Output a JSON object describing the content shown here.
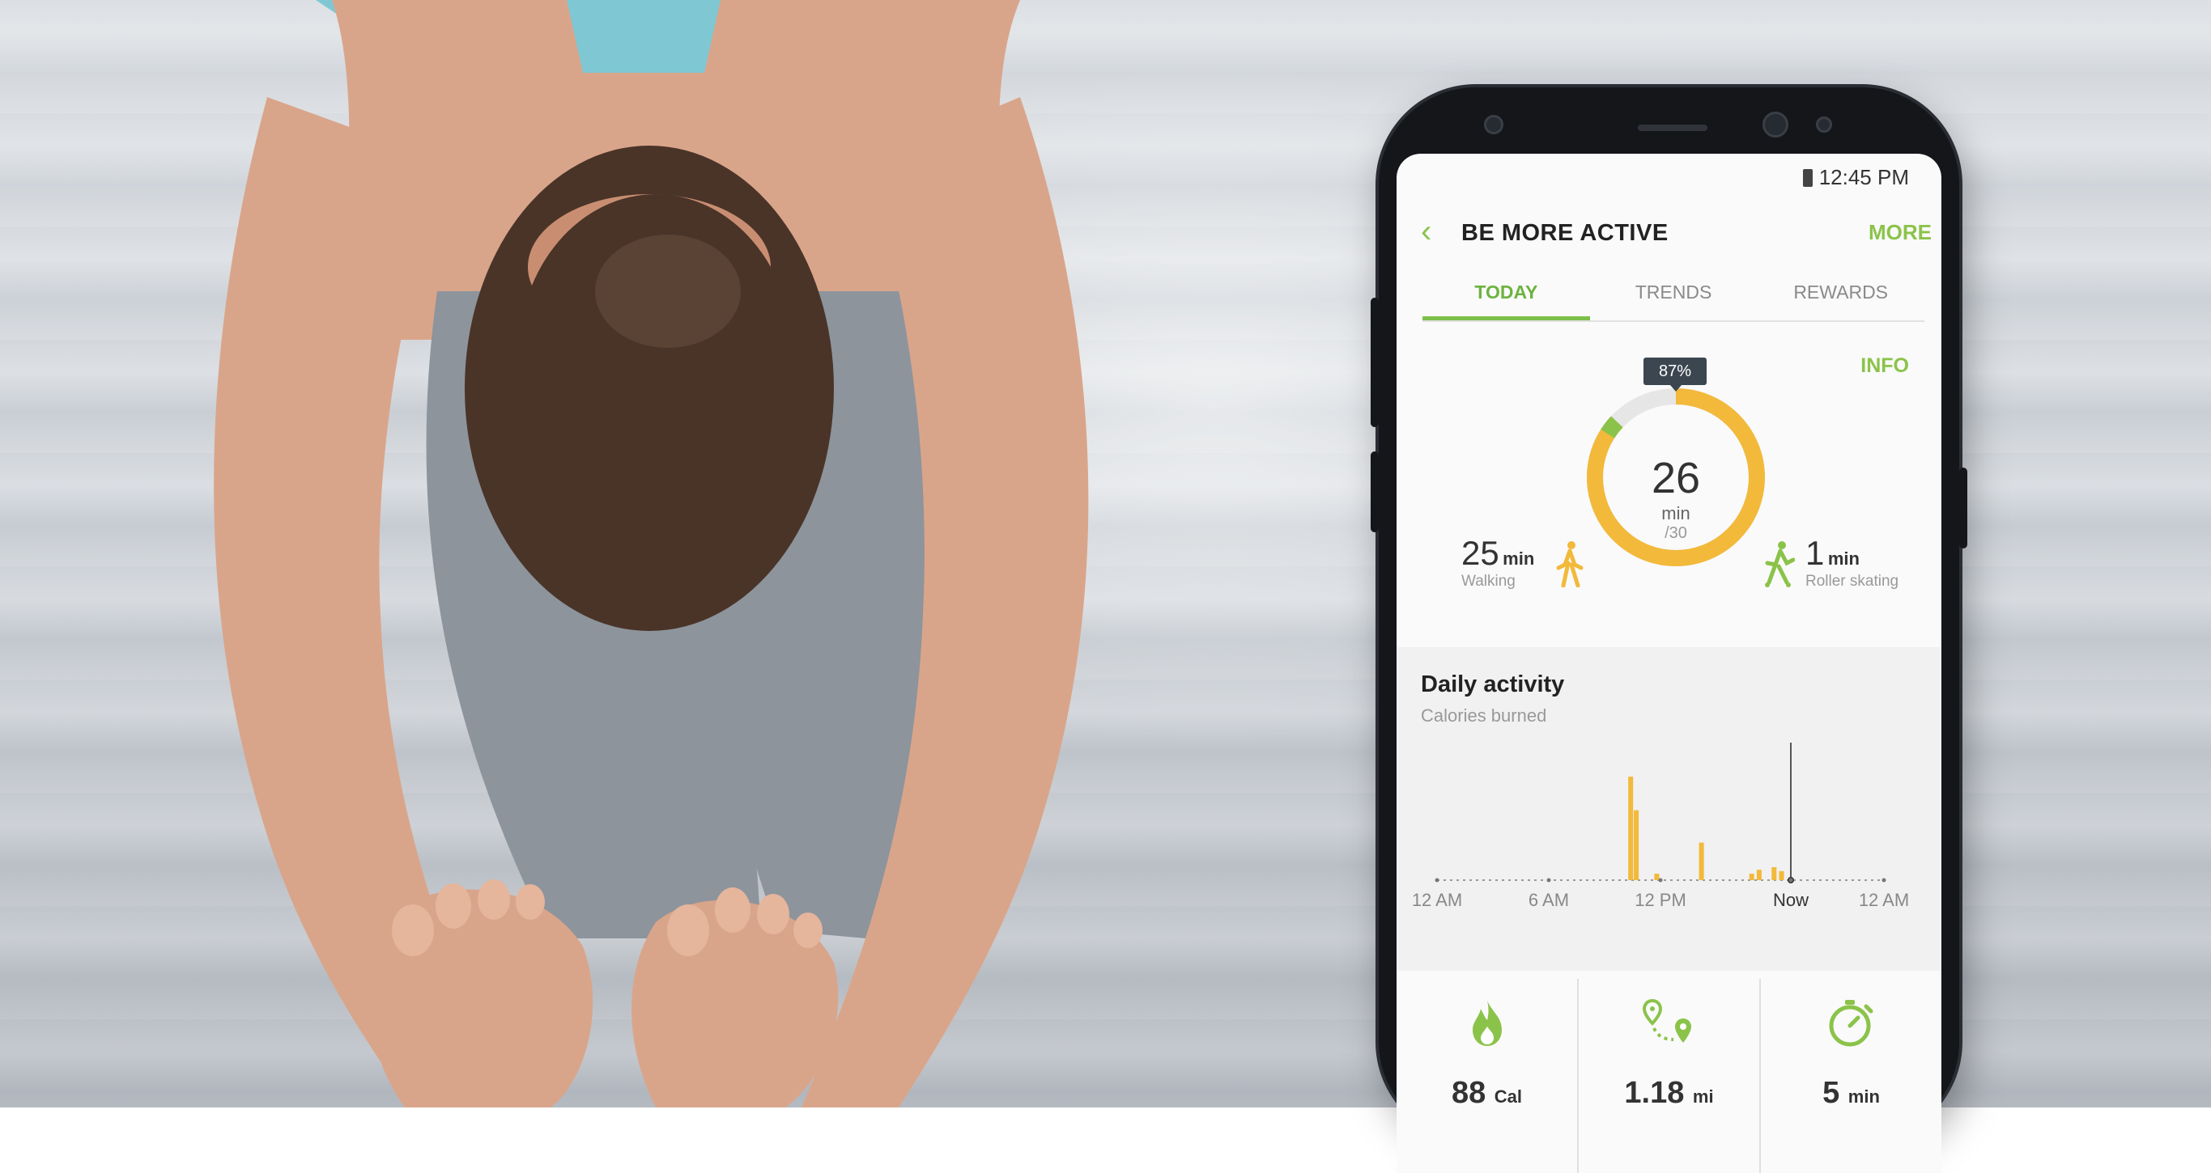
{
  "status": {
    "time": "12:45 PM"
  },
  "app": {
    "title": "BE MORE ACTIVE",
    "more_label": "MORE"
  },
  "tabs": [
    {
      "label": "TODAY",
      "active": true
    },
    {
      "label": "TRENDS",
      "active": false
    },
    {
      "label": "REWARDS",
      "active": false
    }
  ],
  "info_label": "INFO",
  "progress": {
    "percent_label": "87%",
    "percent": 0.87,
    "minutes": "26",
    "unit": "min",
    "goal": "/30"
  },
  "activities": [
    {
      "value": "25",
      "unit": "min",
      "label": "Walking",
      "icon": "walking-icon"
    },
    {
      "value": "1",
      "unit": "min",
      "label": "Roller skating",
      "icon": "roller-skating-icon"
    }
  ],
  "daily": {
    "title": "Daily activity",
    "subtitle": "Calories burned"
  },
  "chart_data": {
    "type": "bar",
    "title": "Daily activity",
    "subtitle": "Calories burned",
    "x_tick_labels": [
      "12 AM",
      "6 AM",
      "12 PM",
      "Now",
      "12 AM"
    ],
    "x_ticks_hours": [
      0,
      6,
      12,
      19,
      24
    ],
    "now_hour": 19,
    "bars": [
      {
        "hour": 10.4,
        "value": 80
      },
      {
        "hour": 10.7,
        "value": 54
      },
      {
        "hour": 11.8,
        "value": 5
      },
      {
        "hour": 14.2,
        "value": 29
      },
      {
        "hour": 16.9,
        "value": 5
      },
      {
        "hour": 17.3,
        "value": 8
      },
      {
        "hour": 18.1,
        "value": 10
      },
      {
        "hour": 18.5,
        "value": 7
      }
    ],
    "ylim": [
      0,
      100
    ],
    "colors": {
      "bar": "#f2b93b",
      "now_line": "#555555"
    }
  },
  "stats": [
    {
      "value": "88",
      "unit": "Cal",
      "icon": "flame-icon"
    },
    {
      "value": "1.18",
      "unit": "mi",
      "icon": "route-icon"
    },
    {
      "value": "5",
      "unit": "min",
      "icon": "stopwatch-icon"
    }
  ],
  "colors": {
    "accent": "#8bc34a",
    "ring": "#f2b93b",
    "ring_track": "#e6e6e6"
  }
}
